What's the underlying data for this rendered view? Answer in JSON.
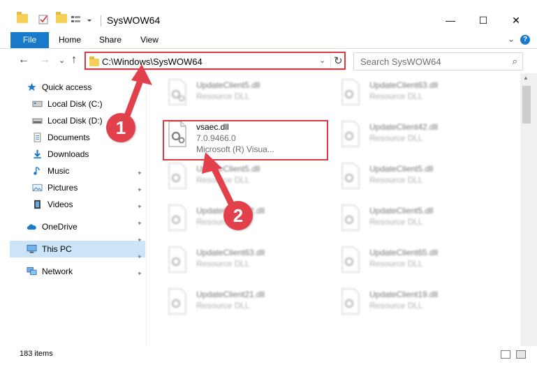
{
  "window": {
    "title": "SysWOW64",
    "min_label": "—",
    "max_label": "☐",
    "close_label": "✕"
  },
  "ribbon": {
    "tabs": [
      "File",
      "Home",
      "Share",
      "View"
    ],
    "help_label": "?",
    "collapse_label": "⌄"
  },
  "nav": {
    "back": "←",
    "forward": "→",
    "recent": "⌄",
    "up": "↑",
    "address": "C:\\Windows\\SysWOW64",
    "address_chevron": "⌄",
    "refresh": "↻",
    "search_placeholder": "Search SysWOW64",
    "search_icon": "⌕"
  },
  "sidebar": {
    "items": [
      {
        "label": "Quick access",
        "icon": "star-icon"
      },
      {
        "label": "Local Disk (C:)",
        "icon": "drive-icon"
      },
      {
        "label": "Local Disk (D:)",
        "icon": "drive-icon"
      },
      {
        "label": "Documents",
        "icon": "documents-icon"
      },
      {
        "label": "Downloads",
        "icon": "download-icon"
      },
      {
        "label": "Music",
        "icon": "music-icon"
      },
      {
        "label": "Pictures",
        "icon": "pictures-icon"
      },
      {
        "label": "Videos",
        "icon": "videos-icon"
      },
      {
        "label": "OneDrive",
        "icon": "cloud-icon"
      },
      {
        "label": "This PC",
        "icon": "computer-icon"
      },
      {
        "label": "Network",
        "icon": "network-icon"
      }
    ],
    "pin_glyph": "📌"
  },
  "files": {
    "highlighted": {
      "name": "vsaec.dll",
      "version": "7.0.9466.0",
      "company": "Microsoft (R) Visua..."
    },
    "tiles": [
      {
        "name": "UpdateClient5.dll",
        "type": "Resource DLL"
      },
      {
        "name": "UpdateClient63.dll",
        "type": "Resource DLL"
      },
      {
        "name": "UpdateClient42.dll",
        "type": "Resource DLL"
      },
      {
        "name": "UpdateClient5.dll",
        "type": "Resource DLL"
      },
      {
        "name": "UpdateClient5.dll",
        "type": "Resource DLL"
      },
      {
        "name": "UpdateClient42.dll",
        "type": "Resource DLL"
      },
      {
        "name": "UpdateClient5.dll",
        "type": "Resource DLL"
      },
      {
        "name": "UpdateClient63.dll",
        "type": "Resource DLL"
      },
      {
        "name": "UpdateClient65.dll",
        "type": "Resource DLL"
      },
      {
        "name": "UpdateClient21.dll",
        "type": "Resource DLL"
      },
      {
        "name": "UpdateClient19.dll",
        "type": "Resource DLL"
      }
    ]
  },
  "status": {
    "count": "183 items"
  },
  "callouts": {
    "one": "1",
    "two": "2"
  },
  "colors": {
    "accent": "#1979ca",
    "highlight": "#d93a45",
    "selection": "#cce4f7"
  }
}
